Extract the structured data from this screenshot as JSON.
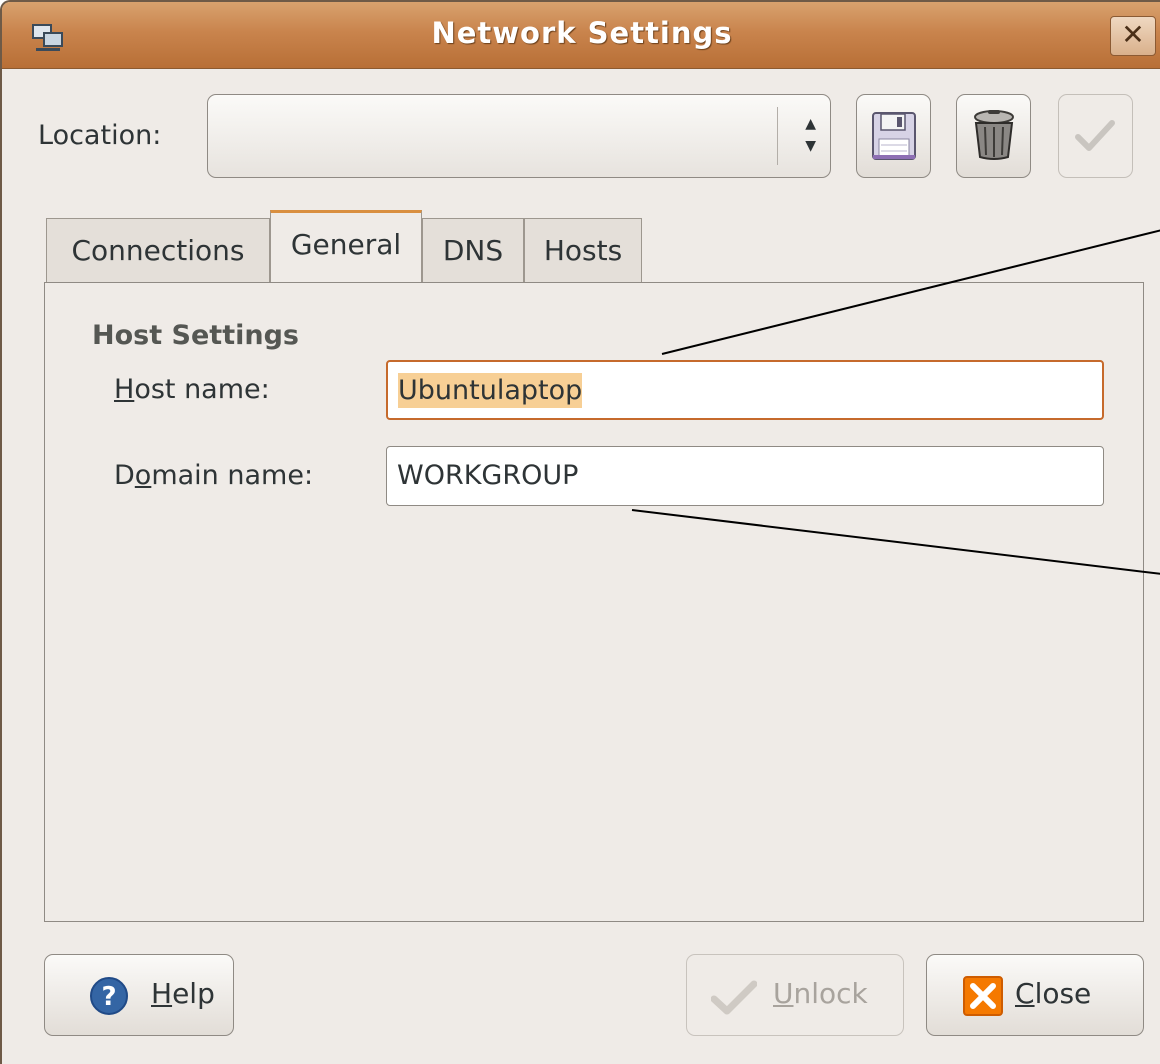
{
  "window": {
    "title": "Network Settings",
    "close_glyph": "✕"
  },
  "location": {
    "label": "Location:",
    "value": "",
    "arrows_up": "▲",
    "arrows_down": "▼"
  },
  "toolbar": {
    "save_icon": "floppy-disk-icon",
    "delete_icon": "trash-can-icon",
    "apply_icon": "checkmark-icon"
  },
  "tabs": [
    {
      "label": "Connections",
      "active": false
    },
    {
      "label": "General",
      "active": true
    },
    {
      "label": "DNS",
      "active": false
    },
    {
      "label": "Hosts",
      "active": false
    }
  ],
  "general": {
    "section_title": "Host Settings",
    "host_label_mnemonic": "H",
    "host_label_rest": "ost name:",
    "host_value": "Ubuntulaptop",
    "domain_label_pre": "D",
    "domain_label_mnemonic": "o",
    "domain_label_post": "main name:",
    "domain_value": "WORKGROUP"
  },
  "buttons": {
    "help_mnemonic": "H",
    "help_rest": "elp",
    "unlock_mnemonic": "U",
    "unlock_rest": "nlock",
    "close_mnemonic": "C",
    "close_rest": "lose"
  },
  "colors": {
    "title_bar": "#c9844d",
    "accent": "#d98f40",
    "selection": "#f7cf95"
  }
}
